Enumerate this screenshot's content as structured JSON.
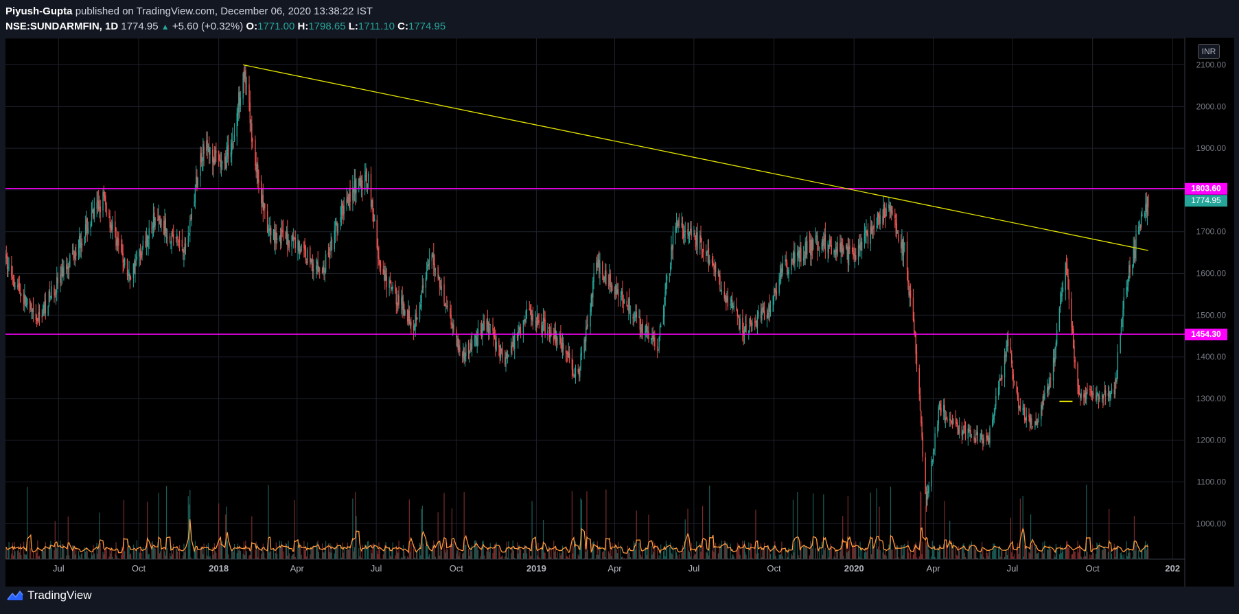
{
  "header": {
    "author": "Piyush-Gupta",
    "published": "published on TradingView.com, December 06, 2020 13:38:22 IST",
    "symbol": "NSE:SUNDARMFIN, 1D",
    "last": "1774.95",
    "change": "+5.60 (+0.32%)",
    "o_label": "O:",
    "o_value": "1771.00",
    "h_label": "H:",
    "h_value": "1798.65",
    "l_label": "L:",
    "l_value": "1711.10",
    "c_label": "C:",
    "c_value": "1774.95"
  },
  "currency": "INR",
  "brand": "TradingView",
  "chart_data": {
    "type": "candlestick",
    "y_range": [
      915,
      2165
    ],
    "y_ticks": [
      "2100.00",
      "2000.00",
      "1900.00",
      "1800.00",
      "1700.00",
      "1600.00",
      "1500.00",
      "1400.00",
      "1300.00",
      "1200.00",
      "1100.00",
      "1000.00"
    ],
    "x_ticks": [
      {
        "label": "Jul",
        "bold": false
      },
      {
        "label": "Oct",
        "bold": false
      },
      {
        "label": "2018",
        "bold": true
      },
      {
        "label": "Apr",
        "bold": false
      },
      {
        "label": "Jul",
        "bold": false
      },
      {
        "label": "Oct",
        "bold": false
      },
      {
        "label": "2019",
        "bold": true
      },
      {
        "label": "Apr",
        "bold": false
      },
      {
        "label": "Jul",
        "bold": false
      },
      {
        "label": "Oct",
        "bold": false
      },
      {
        "label": "2020",
        "bold": true
      },
      {
        "label": "Apr",
        "bold": false
      },
      {
        "label": "Jul",
        "bold": false
      },
      {
        "label": "Oct",
        "bold": false
      },
      {
        "label": "202",
        "bold": true
      }
    ],
    "horizontal_levels": [
      {
        "value": 1803.6,
        "label": "1803.60",
        "color": "#ff00ff"
      },
      {
        "value": 1454.3,
        "label": "1454.30",
        "color": "#ff00ff"
      }
    ],
    "last_price": {
      "value": 1774.95,
      "label": "1774.95",
      "color": "#26a69a"
    },
    "trendline": {
      "from": {
        "date": "2018-01-29",
        "price": 2100
      },
      "to": {
        "date": "2020-12-04",
        "price": 1655
      },
      "color": "#e5e500"
    },
    "short_marker": {
      "from": "2020-08-24",
      "to": "2020-09-08",
      "price": 1293,
      "color": "#e5e500"
    },
    "price_path": [
      [
        "2017-05-01",
        1630
      ],
      [
        "2017-06-05",
        1480
      ],
      [
        "2017-07-10",
        1620
      ],
      [
        "2017-08-21",
        1780
      ],
      [
        "2017-09-20",
        1590
      ],
      [
        "2017-10-20",
        1730
      ],
      [
        "2017-11-24",
        1660
      ],
      [
        "2017-12-14",
        1910
      ],
      [
        "2018-01-05",
        1850
      ],
      [
        "2018-01-19",
        1930
      ],
      [
        "2018-01-29",
        2095
      ],
      [
        "2018-02-12",
        1870
      ],
      [
        "2018-02-26",
        1700
      ],
      [
        "2018-03-28",
        1680
      ],
      [
        "2018-04-30",
        1600
      ],
      [
        "2018-05-28",
        1780
      ],
      [
        "2018-06-22",
        1830
      ],
      [
        "2018-07-06",
        1600
      ],
      [
        "2018-08-13",
        1480
      ],
      [
        "2018-09-03",
        1640
      ],
      [
        "2018-10-08",
        1400
      ],
      [
        "2018-11-05",
        1480
      ],
      [
        "2018-11-26",
        1390
      ],
      [
        "2018-12-21",
        1510
      ],
      [
        "2019-01-28",
        1440
      ],
      [
        "2019-02-18",
        1350
      ],
      [
        "2019-03-11",
        1620
      ],
      [
        "2019-04-15",
        1530
      ],
      [
        "2019-05-20",
        1420
      ],
      [
        "2019-06-10",
        1720
      ],
      [
        "2019-07-08",
        1670
      ],
      [
        "2019-07-31",
        1580
      ],
      [
        "2019-08-26",
        1460
      ],
      [
        "2019-09-24",
        1510
      ],
      [
        "2019-10-14",
        1620
      ],
      [
        "2019-11-25",
        1680
      ],
      [
        "2019-12-30",
        1640
      ],
      [
        "2020-01-20",
        1700
      ],
      [
        "2020-02-10",
        1760
      ],
      [
        "2020-02-28",
        1650
      ],
      [
        "2020-03-11",
        1450
      ],
      [
        "2020-03-24",
        1050
      ],
      [
        "2020-04-08",
        1280
      ],
      [
        "2020-05-05",
        1220
      ],
      [
        "2020-06-03",
        1200
      ],
      [
        "2020-06-26",
        1430
      ],
      [
        "2020-07-10",
        1270
      ],
      [
        "2020-07-29",
        1240
      ],
      [
        "2020-08-17",
        1380
      ],
      [
        "2020-08-31",
        1620
      ],
      [
        "2020-09-15",
        1300
      ],
      [
        "2020-10-12",
        1310
      ],
      [
        "2020-10-26",
        1320
      ],
      [
        "2020-11-09",
        1580
      ],
      [
        "2020-11-23",
        1700
      ],
      [
        "2020-12-04",
        1775
      ]
    ]
  }
}
